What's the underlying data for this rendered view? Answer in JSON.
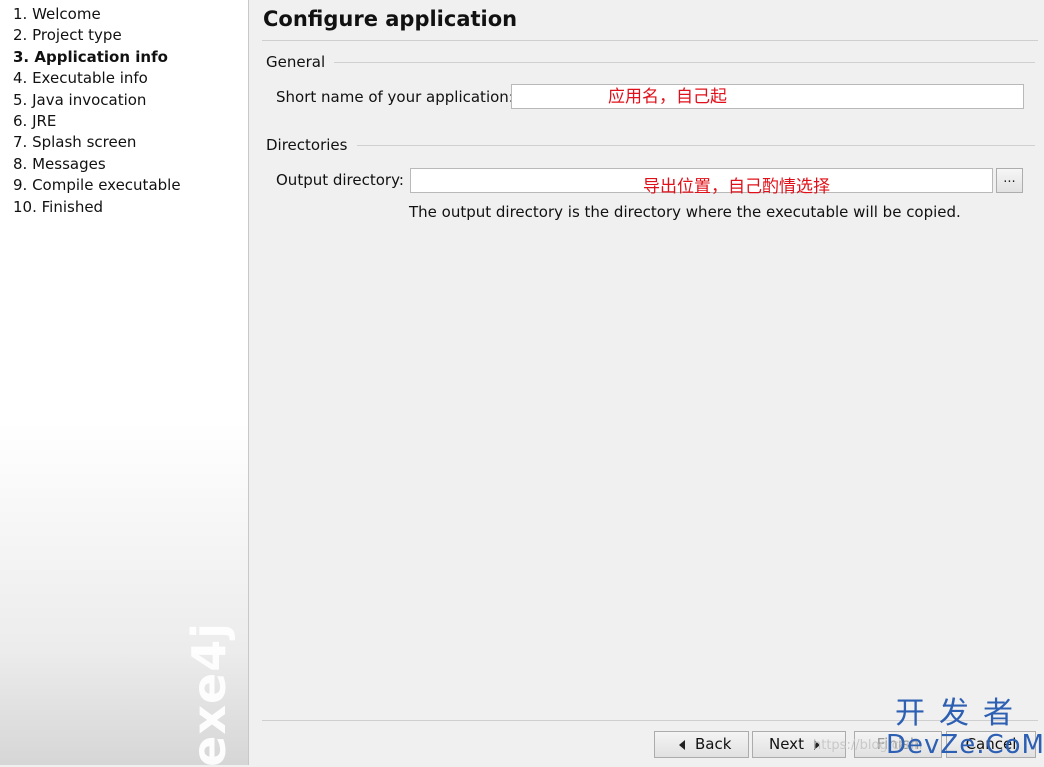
{
  "sidebar": {
    "steps": [
      {
        "label": "1. Welcome"
      },
      {
        "label": "2. Project type"
      },
      {
        "label": "3. Application info"
      },
      {
        "label": "4. Executable info"
      },
      {
        "label": "5. Java invocation"
      },
      {
        "label": "6. JRE"
      },
      {
        "label": "7. Splash screen"
      },
      {
        "label": "8. Messages"
      },
      {
        "label": "9. Compile executable"
      },
      {
        "label": "10. Finished"
      }
    ],
    "active_step_index": 2,
    "brand": "exe4j"
  },
  "main": {
    "title": "Configure application",
    "general": {
      "section_label": "General",
      "short_name_label": "Short name of your application:",
      "short_name_value": "",
      "short_name_annotation": "应用名，自己起"
    },
    "directories": {
      "section_label": "Directories",
      "output_label": "Output directory:",
      "output_value": "",
      "output_annotation": "导出位置，自己酌情选择",
      "browse_label": "...",
      "hint": "The output directory is the directory where the executable will be copied."
    }
  },
  "footer": {
    "back_label": "Back",
    "next_label": "Next",
    "finish_label": "Finish",
    "cancel_label": "Cancel"
  },
  "overlay": {
    "url_watermark": "https://blog.csdn",
    "logo_cn": "开发者",
    "logo_en": "DevZe.CoM"
  },
  "colors": {
    "annotation": "#e0101a",
    "logo": "#2d5fb3"
  }
}
